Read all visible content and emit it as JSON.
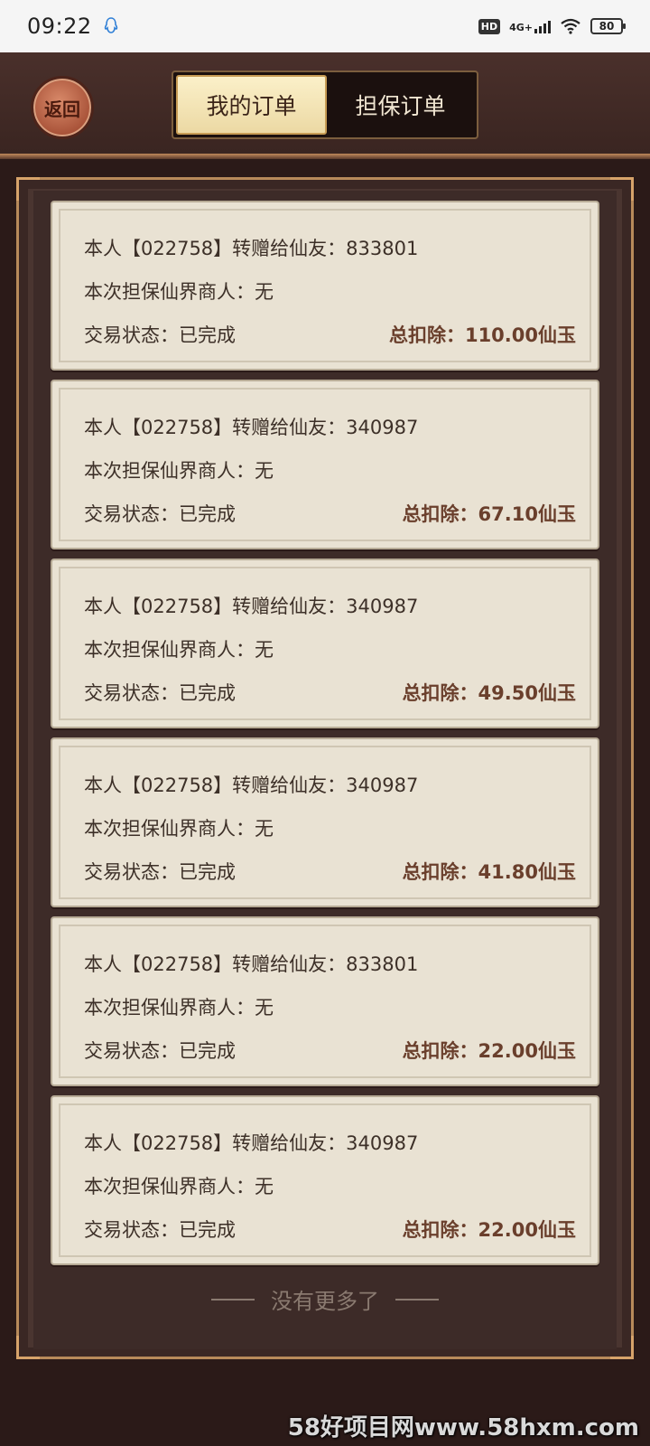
{
  "status_bar": {
    "time": "09:22",
    "hd": "HD",
    "network": "4G+",
    "battery": "80"
  },
  "header": {
    "back_label": "返回",
    "tabs": [
      {
        "label": "我的订单",
        "active": true
      },
      {
        "label": "担保订单",
        "active": false
      }
    ]
  },
  "orders": [
    {
      "line1": "本人【022758】转赠给仙友：833801",
      "line2": "本次担保仙界商人：无",
      "status": "交易状态：已完成",
      "total": "总扣除：110.00仙玉"
    },
    {
      "line1": "本人【022758】转赠给仙友：340987",
      "line2": "本次担保仙界商人：无",
      "status": "交易状态：已完成",
      "total": "总扣除：67.10仙玉"
    },
    {
      "line1": "本人【022758】转赠给仙友：340987",
      "line2": "本次担保仙界商人：无",
      "status": "交易状态：已完成",
      "total": "总扣除：49.50仙玉"
    },
    {
      "line1": "本人【022758】转赠给仙友：340987",
      "line2": "本次担保仙界商人：无",
      "status": "交易状态：已完成",
      "total": "总扣除：41.80仙玉"
    },
    {
      "line1": "本人【022758】转赠给仙友：833801",
      "line2": "本次担保仙界商人：无",
      "status": "交易状态：已完成",
      "total": "总扣除：22.00仙玉"
    },
    {
      "line1": "本人【022758】转赠给仙友：340987",
      "line2": "本次担保仙界商人：无",
      "status": "交易状态：已完成",
      "total": "总扣除：22.00仙玉"
    }
  ],
  "footer": {
    "no_more": "没有更多了"
  },
  "watermark": "58好项目网www.58hxm.com"
}
